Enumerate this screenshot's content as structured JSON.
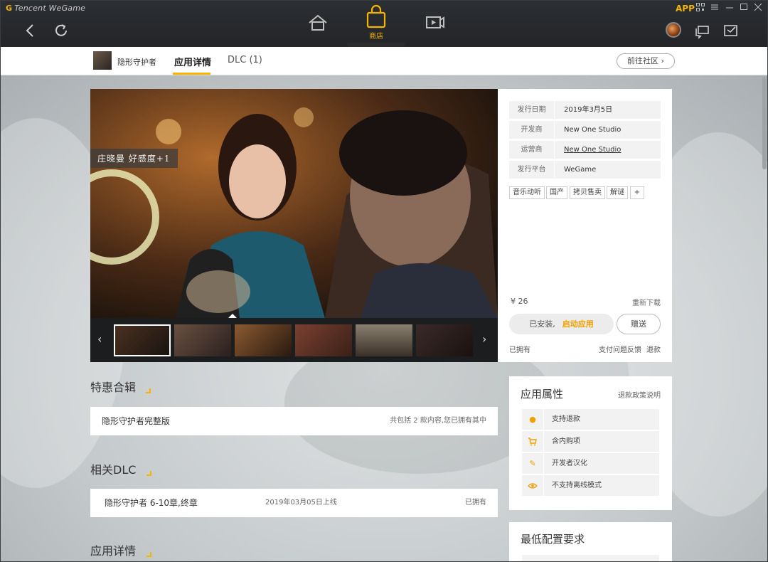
{
  "titlebar": {
    "brand": "Tencent WeGame",
    "app_label": "APP",
    "store_label": "商店",
    "icons": [
      "back-icon",
      "refresh-icon",
      "home-icon",
      "store-bag-icon",
      "video-icon",
      "chat-icon",
      "mail-icon"
    ]
  },
  "subnav": {
    "game_name": "隐形守护者",
    "tabs": [
      {
        "label": "应用详情",
        "active": true
      },
      {
        "label": "DLC (1)",
        "active": false
      }
    ],
    "community_button": "前往社区"
  },
  "hero": {
    "overlay_text": "庄晓曼  好感度+1",
    "thumbnail_count": 6,
    "active_thumbnail": 1
  },
  "info": {
    "rows": [
      {
        "key": "发行日期",
        "value": "2019年3月5日"
      },
      {
        "key": "开发商",
        "value": "New One Studio"
      },
      {
        "key": "运营商",
        "value": "New One Studio"
      },
      {
        "key": "发行平台",
        "value": "WeGame"
      }
    ],
    "tags": [
      "音乐动听",
      "国产",
      "拷贝售卖",
      "解谜",
      "+"
    ],
    "price": "¥ 26",
    "redownload": "重新下载",
    "installed_label": "已安装,",
    "launch_label": "启动应用",
    "gift_label": "赠送",
    "owned": "已拥有",
    "feedback": "支付问题反馈",
    "refund": "退款"
  },
  "sections": {
    "bundle_title": "特惠合辑",
    "bundle_item": "隐形守护者完整版",
    "bundle_desc": "共包括 2 款内容,您已拥有其中",
    "dlc_title": "相关DLC",
    "dlc_item": "隐形守护者 6-10章,终章",
    "dlc_date": "2019年03月05日上线",
    "dlc_status": "已拥有",
    "details_title": "应用详情"
  },
  "attributes": {
    "title": "应用属性",
    "policy_link": "退款政策说明",
    "items": [
      {
        "icon": "refund-icon",
        "label": "支持退款"
      },
      {
        "icon": "cart-icon",
        "label": "含内购项"
      },
      {
        "icon": "pencil-icon",
        "label": "开发者汉化"
      },
      {
        "icon": "no-offline-icon",
        "label": "不支持离线模式"
      }
    ]
  },
  "config": {
    "title": "最低配置要求"
  },
  "colors": {
    "accent": "#f5b400",
    "titlebar": "#2a2c30"
  }
}
